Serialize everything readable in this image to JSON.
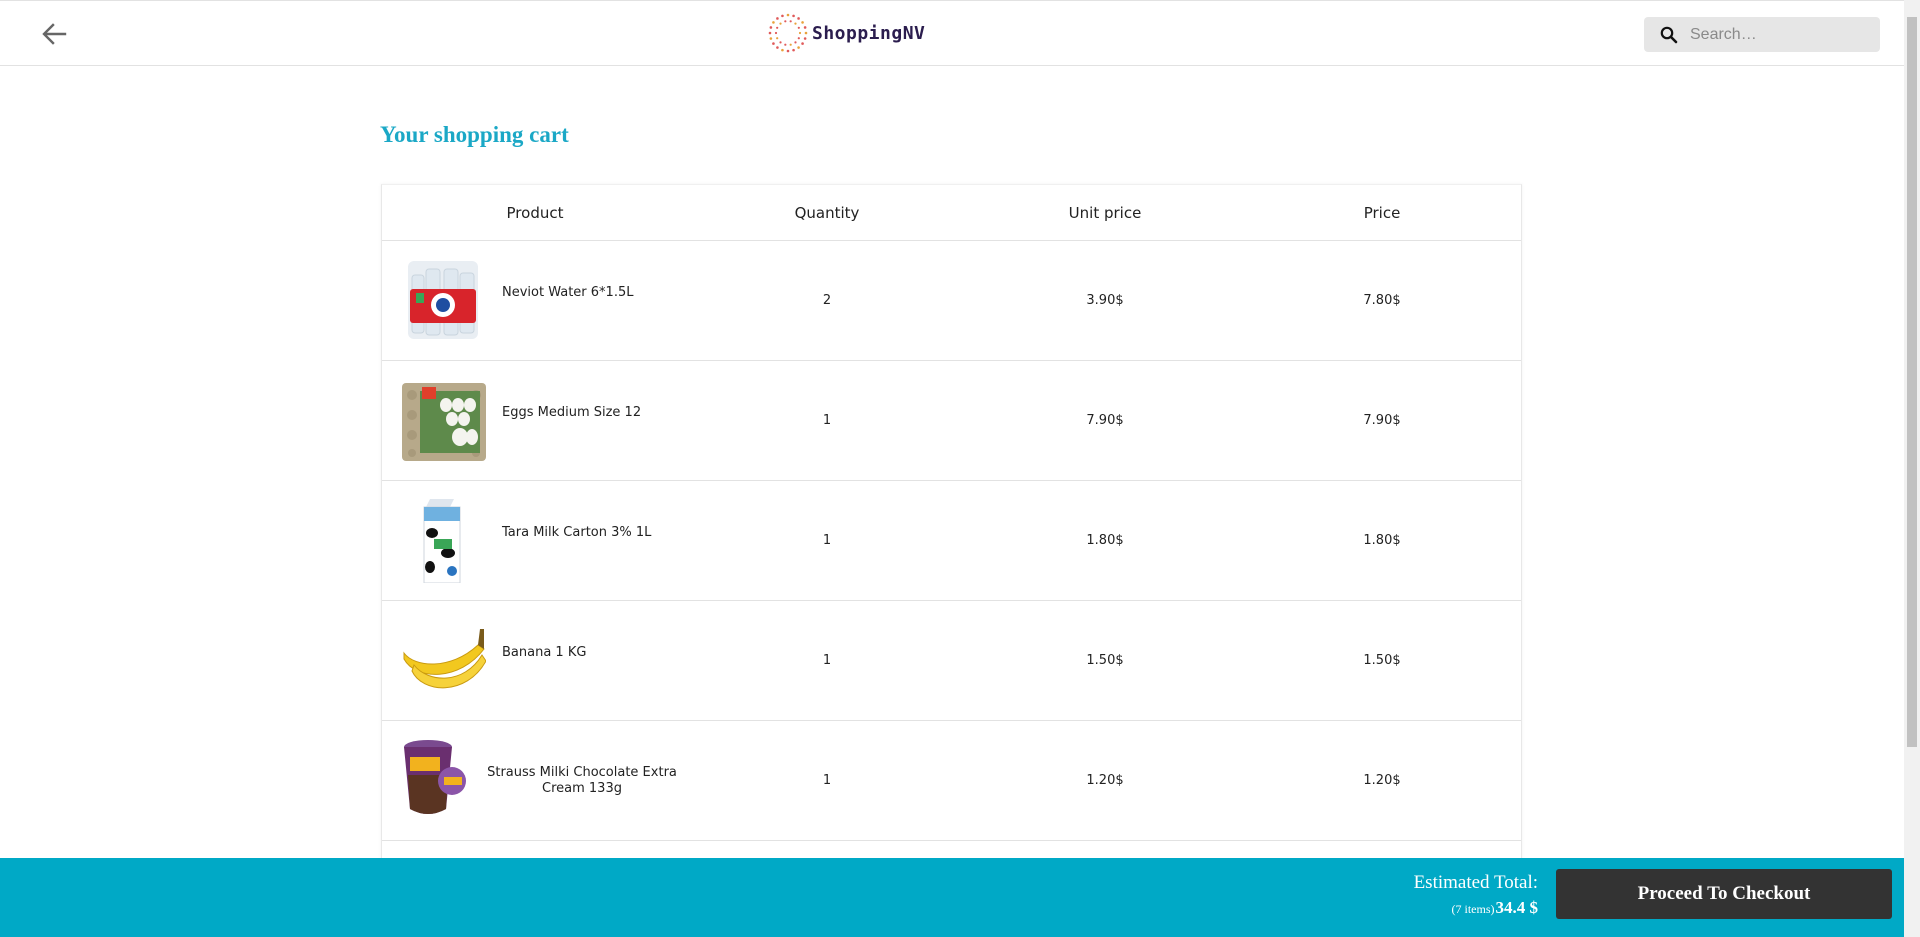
{
  "header": {
    "logo_text": "ShoppingNV",
    "search_placeholder": "Search…"
  },
  "cart": {
    "title": "Your shopping cart",
    "columns": [
      "Product",
      "Quantity",
      "Unit price",
      "Price"
    ],
    "items": [
      {
        "name": "Neviot Water 6*1.5L",
        "quantity": "2",
        "unit_price": "3.90$",
        "price": "7.80$",
        "image_icon": "water-bottles-pack-image"
      },
      {
        "name": "Eggs Medium Size 12",
        "quantity": "1",
        "unit_price": "7.90$",
        "price": "7.90$",
        "image_icon": "egg-carton-image"
      },
      {
        "name": "Tara Milk Carton 3% 1L",
        "quantity": "1",
        "unit_price": "1.80$",
        "price": "1.80$",
        "image_icon": "milk-carton-image"
      },
      {
        "name": "Banana 1 KG",
        "quantity": "1",
        "unit_price": "1.50$",
        "price": "1.50$",
        "image_icon": "banana-image"
      },
      {
        "name": "Strauss Milki Chocolate Extra Cream 133g",
        "quantity": "1",
        "unit_price": "1.20$",
        "price": "1.20$",
        "image_icon": "chocolate-pudding-cup-image"
      }
    ]
  },
  "footer": {
    "estimated_label": "Estimated Total:",
    "item_count": "(7 items)",
    "total": "34.4 $",
    "checkout_label": "Proceed To Checkout"
  },
  "colors": {
    "accent": "#00a9c6",
    "title": "#1ba8c6",
    "checkout_button": "#333333"
  }
}
